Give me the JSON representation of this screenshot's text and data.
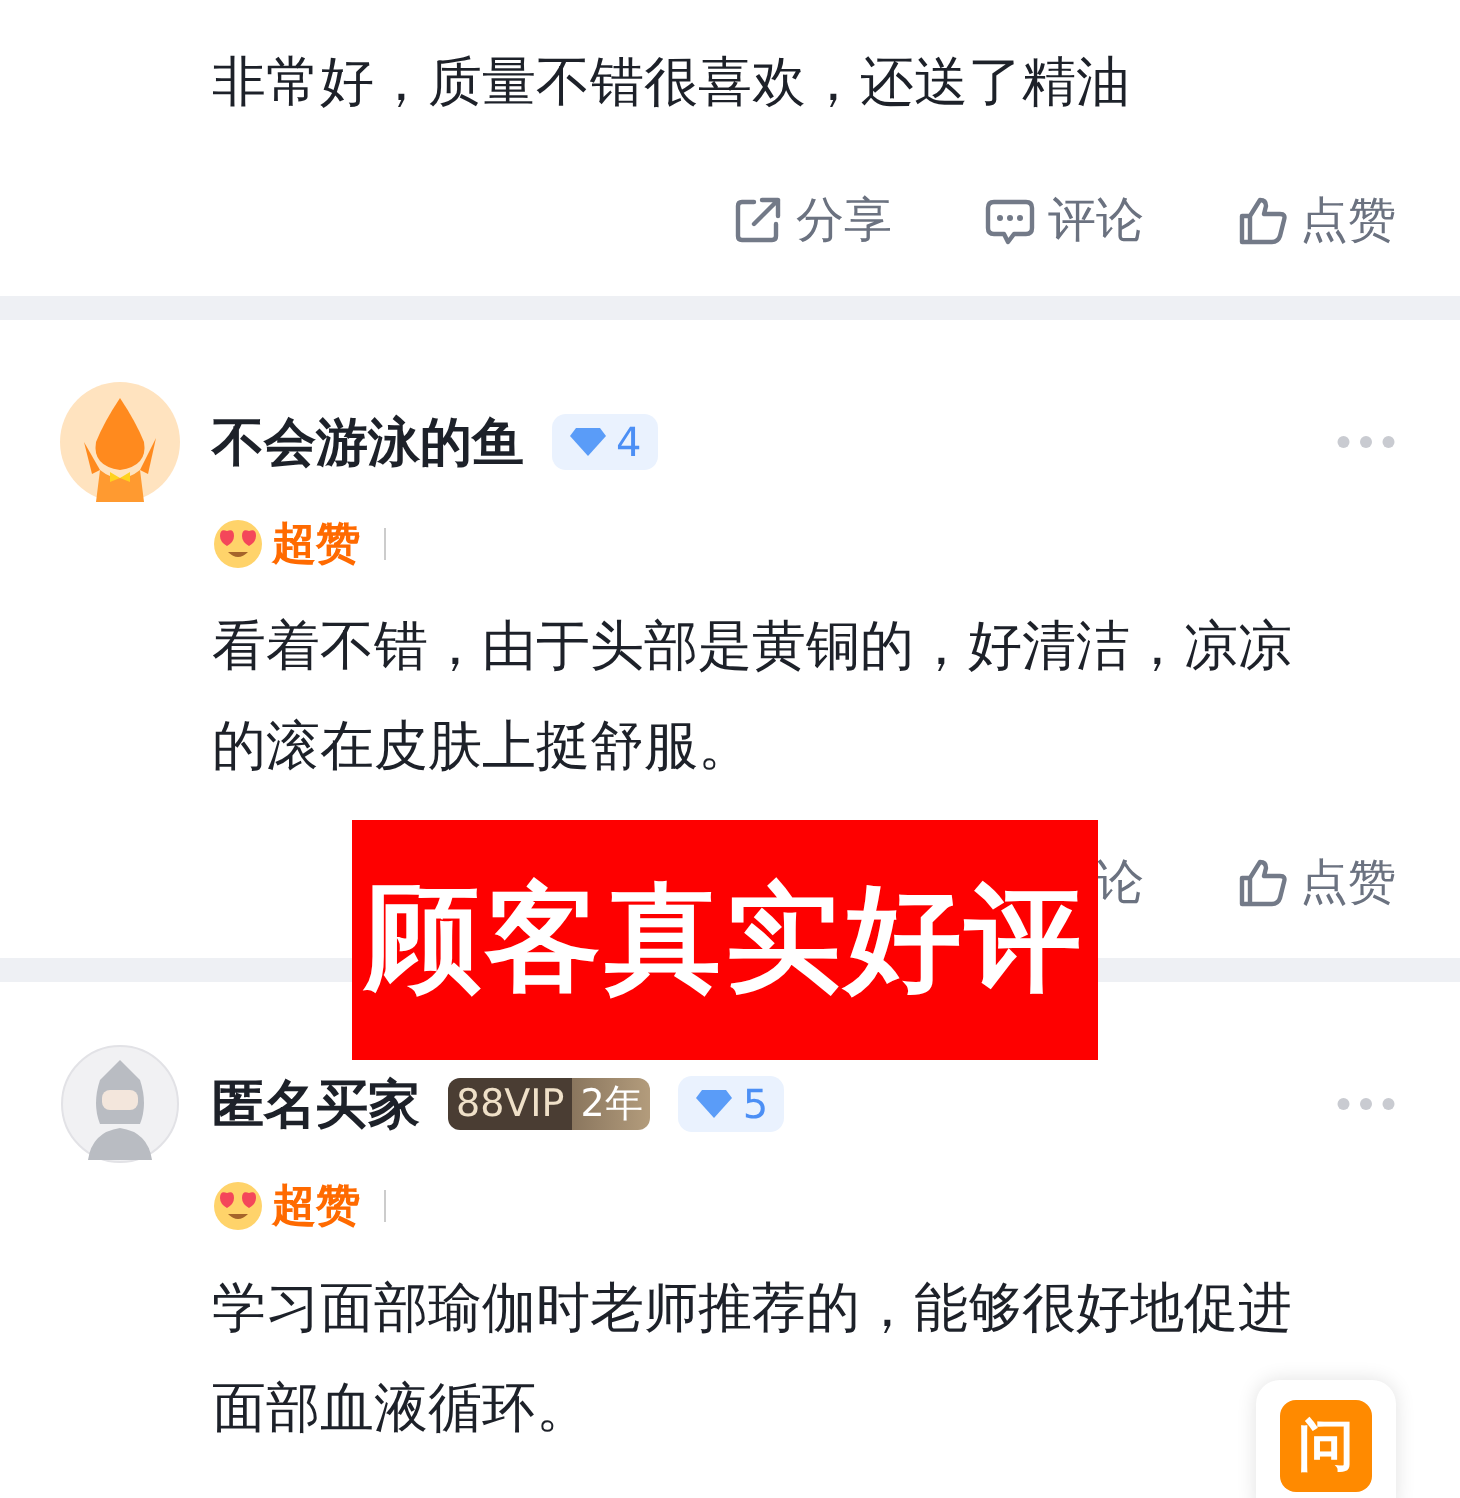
{
  "reviews": [
    {
      "lines": [
        "非常好，质量不错很喜欢，还送了精油"
      ],
      "actions": [
        {
          "kind": "share",
          "label": "分享"
        },
        {
          "kind": "comment",
          "label": "评论"
        },
        {
          "kind": "like",
          "label": "点赞"
        }
      ]
    },
    {
      "avatar": {
        "kind": "mascot"
      },
      "name": "不会游泳的鱼",
      "level": "4",
      "rating": "超赞",
      "lines": [
        "看着不错，由于头部是黄铜的，好清洁，凉凉",
        "的滚在皮肤上挺舒服。"
      ],
      "actions": [
        {
          "kind": "comment_partial",
          "label": "论"
        },
        {
          "kind": "like",
          "label": "点赞"
        }
      ]
    },
    {
      "avatar": {
        "kind": "anonymous"
      },
      "name": "匿名买家",
      "vip": {
        "label": "88VIP",
        "years": "2年"
      },
      "level": "5",
      "rating": "超赞",
      "lines": [
        "学习面部瑜伽时老师推荐的，能够很好地促进",
        "面部血液循环。"
      ]
    }
  ],
  "overlay_banner": {
    "text": "顾客真实好评"
  },
  "ask_button": {
    "label": "问"
  }
}
